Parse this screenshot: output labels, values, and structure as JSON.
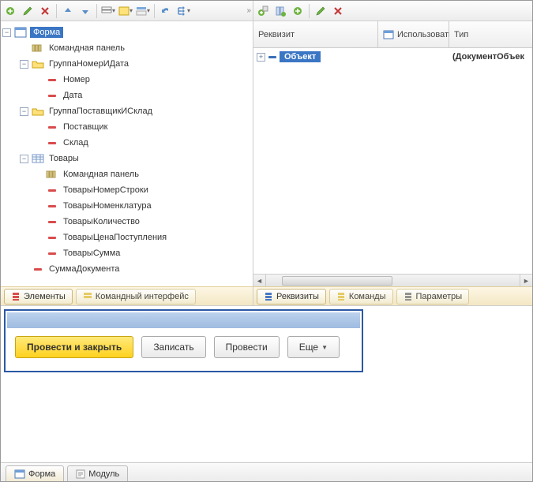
{
  "tree": {
    "root_label": "Форма",
    "items": [
      {
        "label": "Командная панель",
        "icon": "cmdpanel",
        "indent": 1
      },
      {
        "label": "ГруппаНомерИДата",
        "icon": "folder",
        "indent": 1,
        "expander": "minus"
      },
      {
        "label": "Номер",
        "icon": "bar-red",
        "indent": 2
      },
      {
        "label": "Дата",
        "icon": "bar-red",
        "indent": 2
      },
      {
        "label": "ГруппаПоставщикИСклад",
        "icon": "folder",
        "indent": 1,
        "expander": "minus"
      },
      {
        "label": "Поставщик",
        "icon": "bar-red",
        "indent": 2
      },
      {
        "label": "Склад",
        "icon": "bar-red",
        "indent": 2
      },
      {
        "label": "Товары",
        "icon": "table",
        "indent": 1,
        "expander": "minus"
      },
      {
        "label": "Командная панель",
        "icon": "cmdpanel",
        "indent": 2
      },
      {
        "label": "ТоварыНомерСтроки",
        "icon": "bar-red",
        "indent": 2
      },
      {
        "label": "ТоварыНоменклатура",
        "icon": "bar-red",
        "indent": 2
      },
      {
        "label": "ТоварыКоличество",
        "icon": "bar-red",
        "indent": 2
      },
      {
        "label": "ТоварыЦенаПоступления",
        "icon": "bar-red",
        "indent": 2
      },
      {
        "label": "ТоварыСумма",
        "icon": "bar-red",
        "indent": 2
      },
      {
        "label": "СуммаДокумента",
        "icon": "bar-red",
        "indent": 1
      }
    ]
  },
  "left_tabs": {
    "elements": "Элементы",
    "command_interface": "Командный интерфейс"
  },
  "attributes": {
    "header": {
      "col1": "Реквизит",
      "col2": "Использовать",
      "col3": "Тип"
    },
    "row": {
      "name": "Объект",
      "type": "(ДокументОбъек"
    }
  },
  "right_tabs": {
    "attributes": "Реквизиты",
    "commands": "Команды",
    "parameters": "Параметры"
  },
  "preview": {
    "post_and_close": "Провести и закрыть",
    "write": "Записать",
    "post": "Провести",
    "more": "Еще"
  },
  "main_tabs": {
    "form": "Форма",
    "module": "Модуль"
  }
}
